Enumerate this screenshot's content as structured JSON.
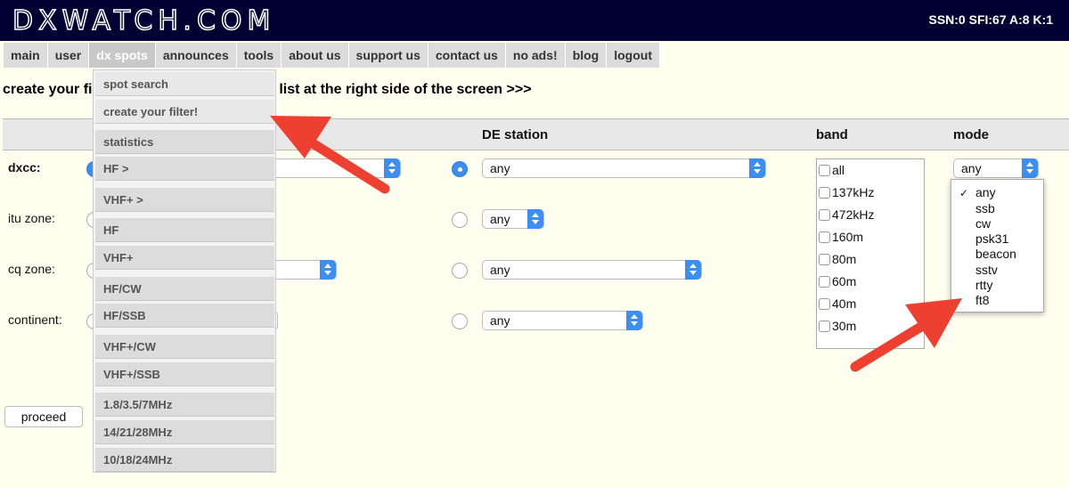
{
  "header": {
    "logo": "DXWATCH.COM",
    "solar": "SSN:0 SFI:67 A:8 K:1"
  },
  "menu": [
    {
      "label": "main"
    },
    {
      "label": "user"
    },
    {
      "label": "dx spots",
      "active": true
    },
    {
      "label": "announces"
    },
    {
      "label": "tools"
    },
    {
      "label": "about us"
    },
    {
      "label": "support us"
    },
    {
      "label": "contact us"
    },
    {
      "label": "no ads!"
    },
    {
      "label": "blog"
    },
    {
      "label": "logout"
    }
  ],
  "intro": {
    "left": "create your fi",
    "right": "e list at the right side of the screen >>>"
  },
  "columns": {
    "de_station": "DE station",
    "band": "band",
    "mode": "mode"
  },
  "rows": {
    "dxcc": "dxcc:",
    "itu_zone": "itu zone:",
    "cq_zone": "cq zone:",
    "continent": "continent:"
  },
  "de_selects": {
    "dxcc": "any",
    "itu": "any",
    "cq": "any",
    "continent": "any"
  },
  "band_list": [
    "all",
    "137kHz",
    "472kHz",
    "160m",
    "80m",
    "60m",
    "40m",
    "30m"
  ],
  "mode_select": {
    "value": "any",
    "options": [
      "any",
      "ssb",
      "cw",
      "psk31",
      "beacon",
      "sstv",
      "rtty",
      "ft8"
    ],
    "selected_mark": "✓"
  },
  "proceed_label": "proceed",
  "dx_spots_menu": [
    "spot search",
    "create your filter!",
    "statistics",
    "HF >",
    "VHF+ >",
    "HF",
    "VHF+",
    "HF/CW",
    "HF/SSB",
    "VHF+/CW",
    "VHF+/SSB",
    "1.8/3.5/7MHz",
    "14/21/28MHz",
    "10/18/24MHz"
  ],
  "colors": {
    "header_bg": "#000033",
    "accent_blue": "#3b8ff3",
    "annotation_arrow": "#ee4030"
  }
}
